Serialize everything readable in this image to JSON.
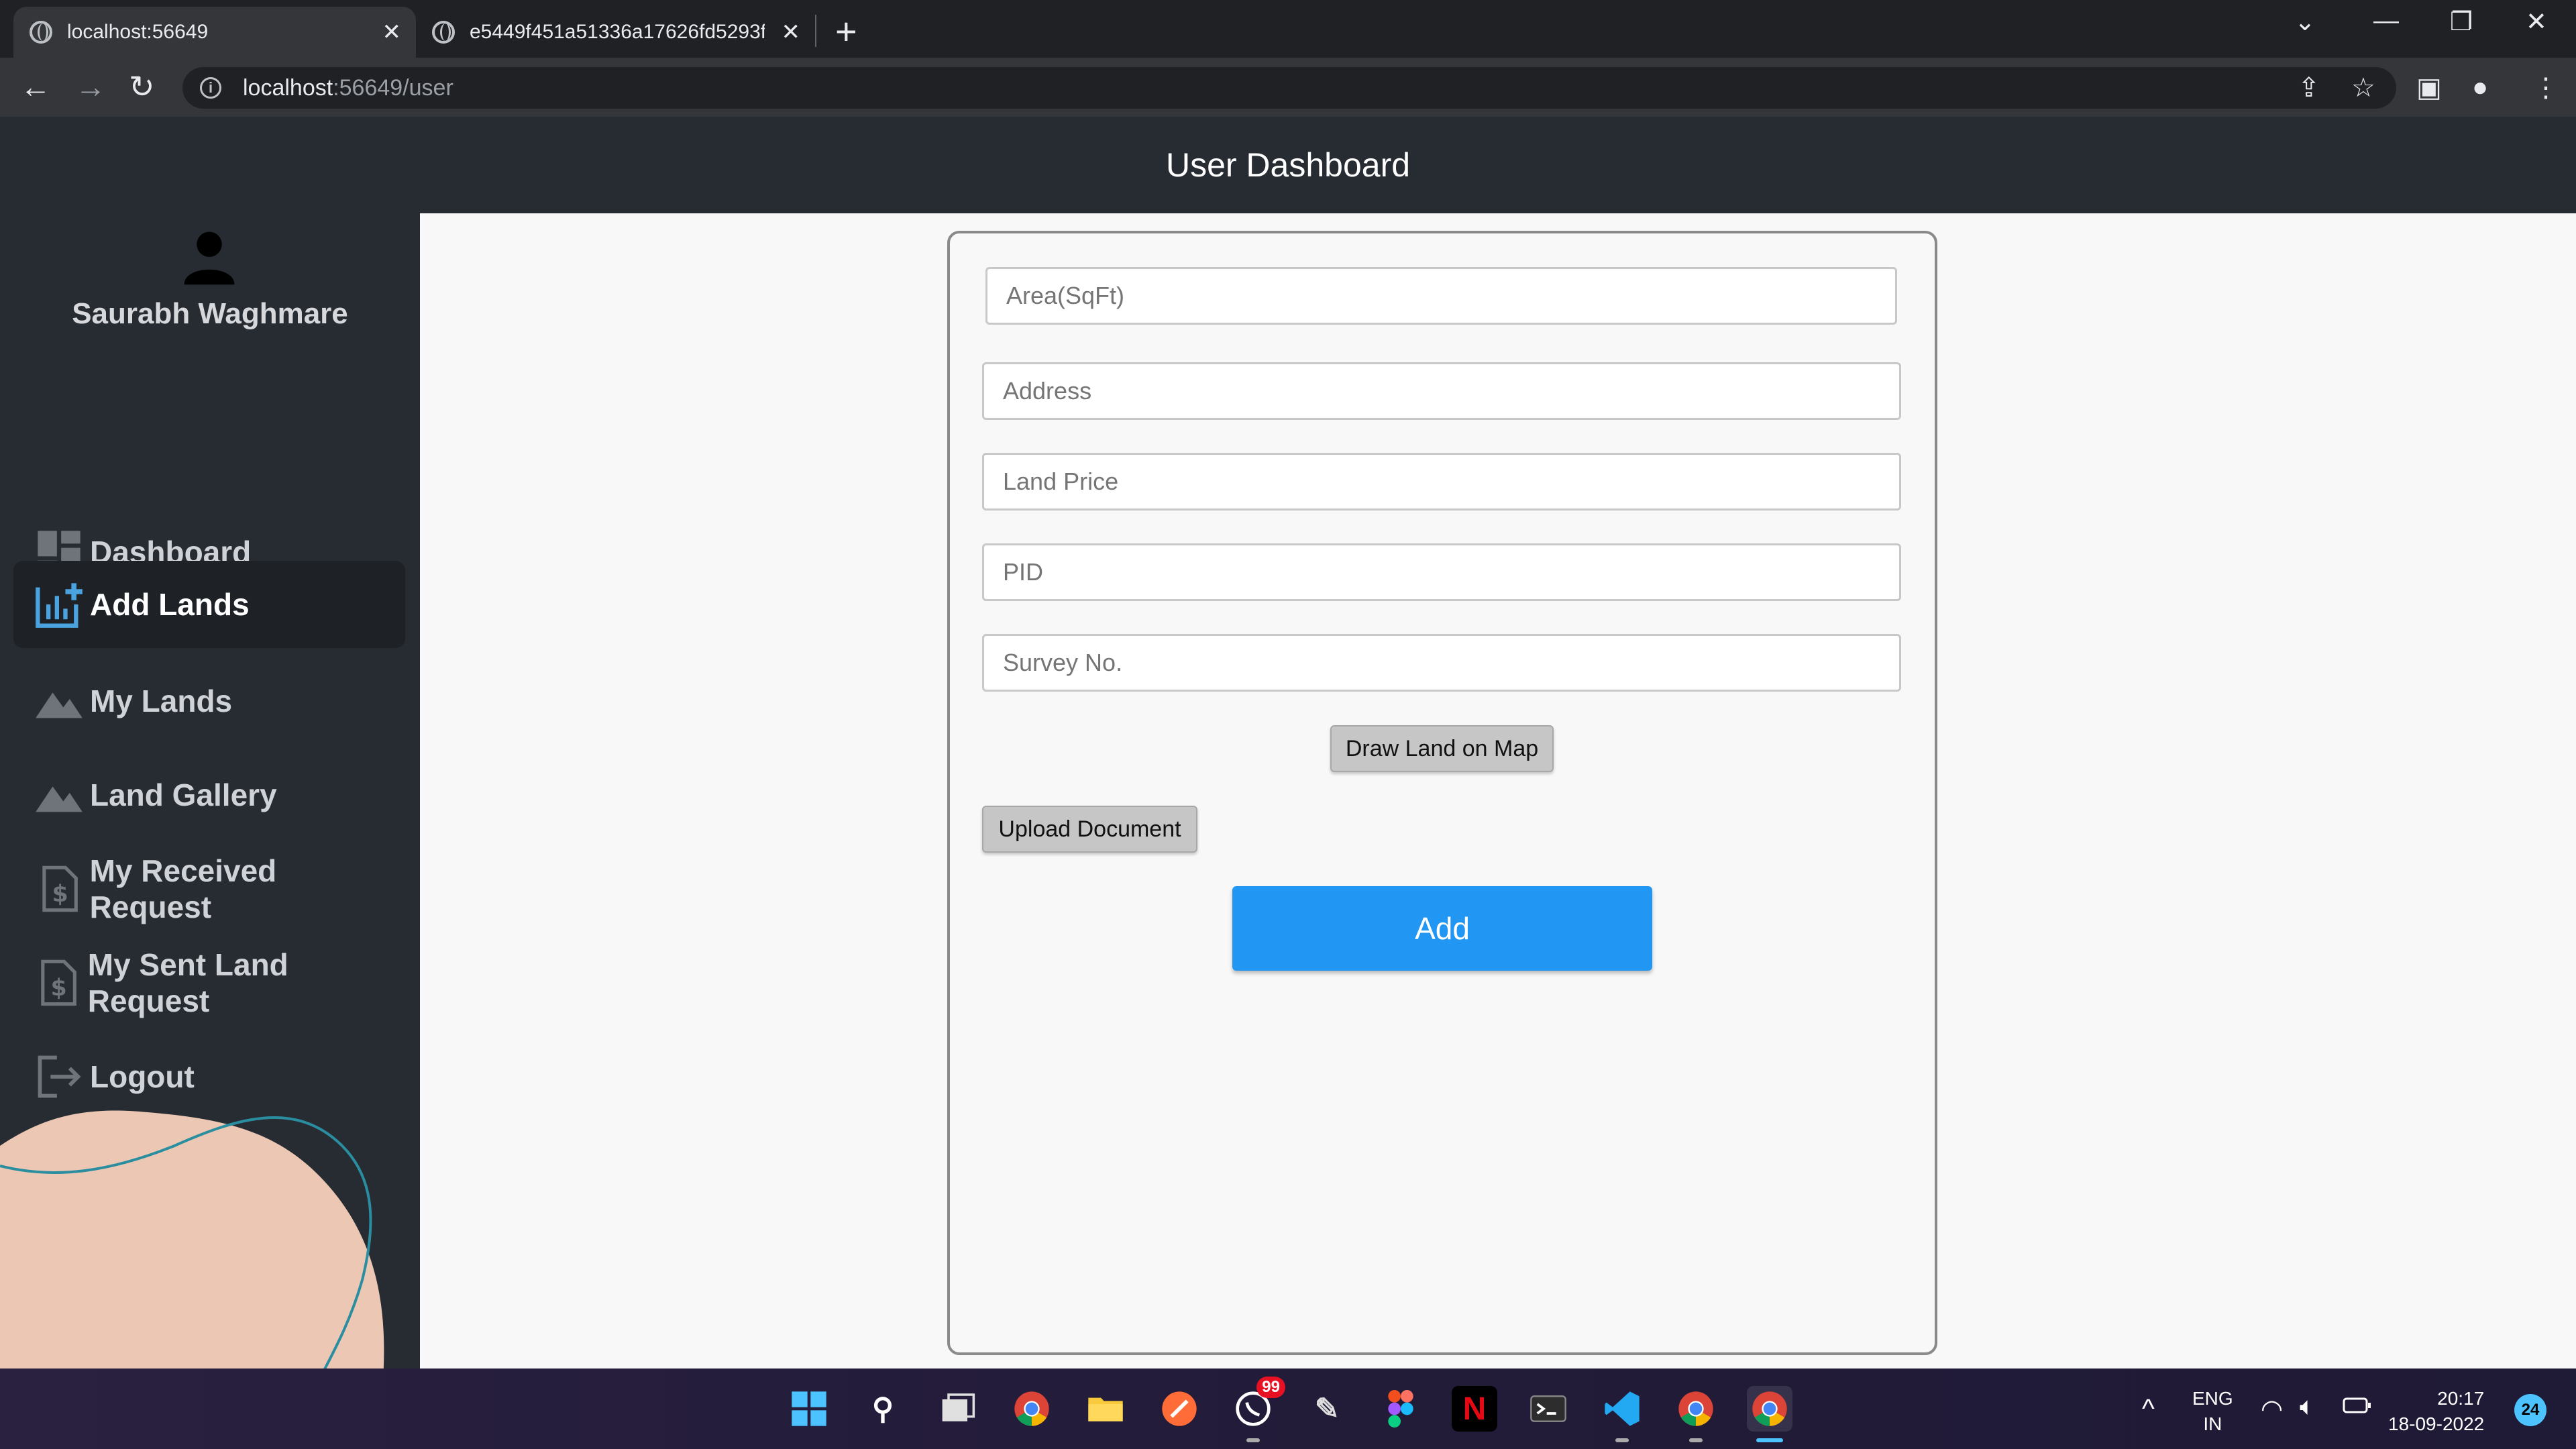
{
  "browser": {
    "tabs": [
      {
        "title": "localhost:56649",
        "active": true
      },
      {
        "title": "e5449f451a51336a17626fd5293f",
        "active": false
      }
    ],
    "url_host": "localhost",
    "url_rest": ":56649/user"
  },
  "header": {
    "title": "User Dashboard"
  },
  "sidebar": {
    "username": "Saurabh Waghmare",
    "items": [
      {
        "label": "Dashboard",
        "icon": "dashboard-icon"
      },
      {
        "label": "Add Lands",
        "icon": "add-chart-icon",
        "active": true
      },
      {
        "label": "My Lands",
        "icon": "landscape-icon"
      },
      {
        "label": "Land Gallery",
        "icon": "landscape-icon"
      },
      {
        "label": "My Received Request",
        "icon": "dollar-document-icon"
      },
      {
        "label": "My Sent Land Request",
        "icon": "dollar-document-icon"
      },
      {
        "label": "Logout",
        "icon": "logout-icon"
      }
    ]
  },
  "form": {
    "area_placeholder": "Area(SqFt)",
    "address_placeholder": "Address",
    "price_placeholder": "Land Price",
    "pid_placeholder": "PID",
    "survey_placeholder": "Survey No.",
    "draw_map_label": "Draw Land on Map",
    "upload_label": "Upload Document",
    "add_label": "Add"
  },
  "taskbar": {
    "whatsapp_badge": "99",
    "lang_line1": "ENG",
    "lang_line2": "IN",
    "time": "20:17",
    "date": "18-09-2022",
    "notifications": "24"
  },
  "colors": {
    "sidebar_bg": "#272c33",
    "accent_button": "#2196f3",
    "main_bg": "#f8f8f8"
  }
}
